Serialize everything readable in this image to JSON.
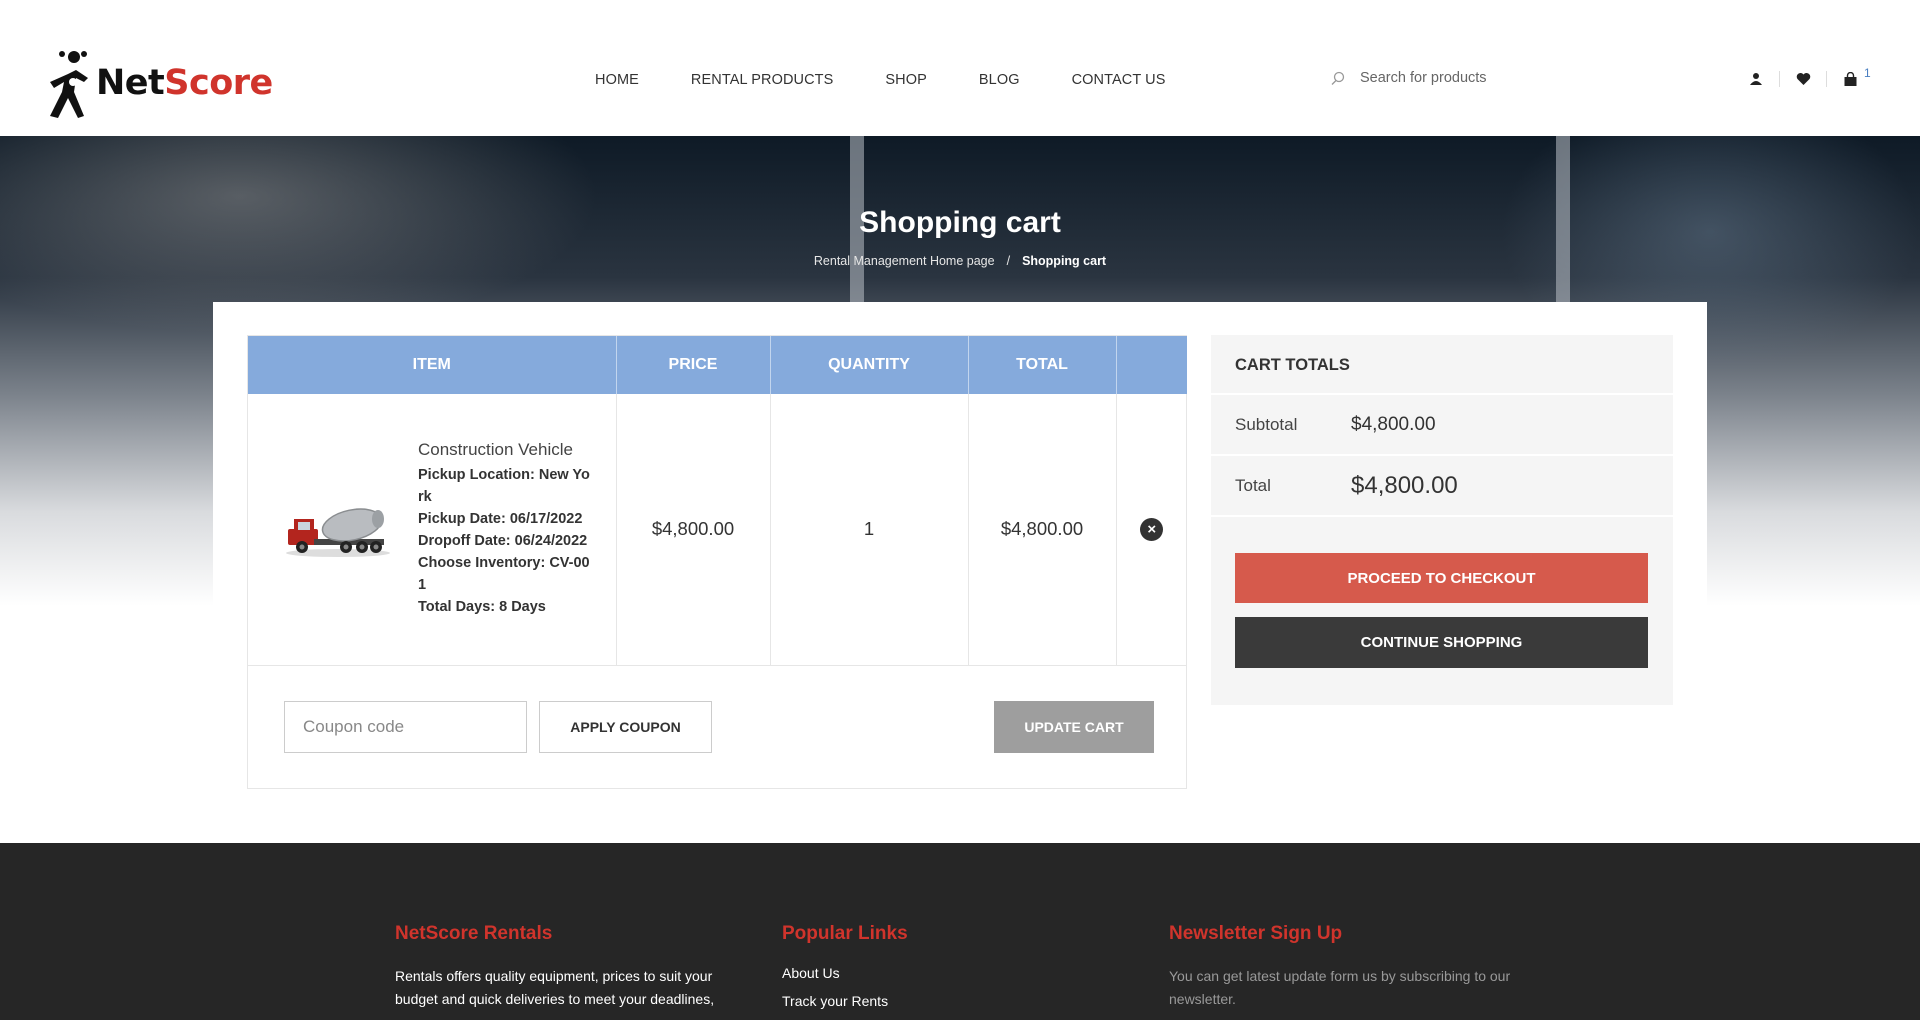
{
  "header": {
    "logo": {
      "net": "Net",
      "score": "Score"
    },
    "nav": [
      "HOME",
      "RENTAL PRODUCTS",
      "SHOP",
      "BLOG",
      "CONTACT US"
    ],
    "search_placeholder": "Search for products",
    "cart_count": "1",
    "icons": [
      "user-icon",
      "heart-icon",
      "shopping-bag-icon"
    ]
  },
  "hero": {
    "title": "Shopping cart",
    "breadcrumb": {
      "home": "Rental Management Home page",
      "separator": "/",
      "current": "Shopping cart"
    }
  },
  "cart": {
    "columns": {
      "item": "ITEM",
      "price": "PRICE",
      "quantity": "QUANTITY",
      "total": "TOTAL"
    },
    "items": [
      {
        "name": "Construction Vehicle",
        "meta": [
          "Pickup Location: New York",
          "Pickup Date: 06/17/2022",
          "Dropoff Date: 06/24/2022",
          "Choose Inventory: CV-001",
          "Total Days: 8 Days"
        ],
        "price": "$4,800.00",
        "quantity": "1",
        "total": "$4,800.00"
      }
    ],
    "coupon_placeholder": "Coupon code",
    "apply_label": "APPLY COUPON",
    "update_label": "UPDATE CART"
  },
  "totals": {
    "title": "CART TOTALS",
    "subtotal_label": "Subtotal",
    "subtotal_value": "$4,800.00",
    "total_label": "Total",
    "total_value": "$4,800.00",
    "checkout_label": "PROCEED TO CHECKOUT",
    "continue_label": "CONTINUE SHOPPING"
  },
  "footer": {
    "col1": {
      "title": "NetScore Rentals",
      "text": "Rentals offers quality equipment, prices to suit your budget and quick deliveries to meet your deadlines,"
    },
    "col2": {
      "title": "Popular Links",
      "links": [
        "About Us",
        "Track your Rents"
      ]
    },
    "col3": {
      "title": "Newsletter Sign Up",
      "text": "You can get latest update form us by subscribing to our newsletter."
    }
  },
  "colors": {
    "accent_red": "#d0342c",
    "table_header": "#85aadc",
    "checkout": "#d65a4c",
    "dark": "#3a3a3a"
  }
}
